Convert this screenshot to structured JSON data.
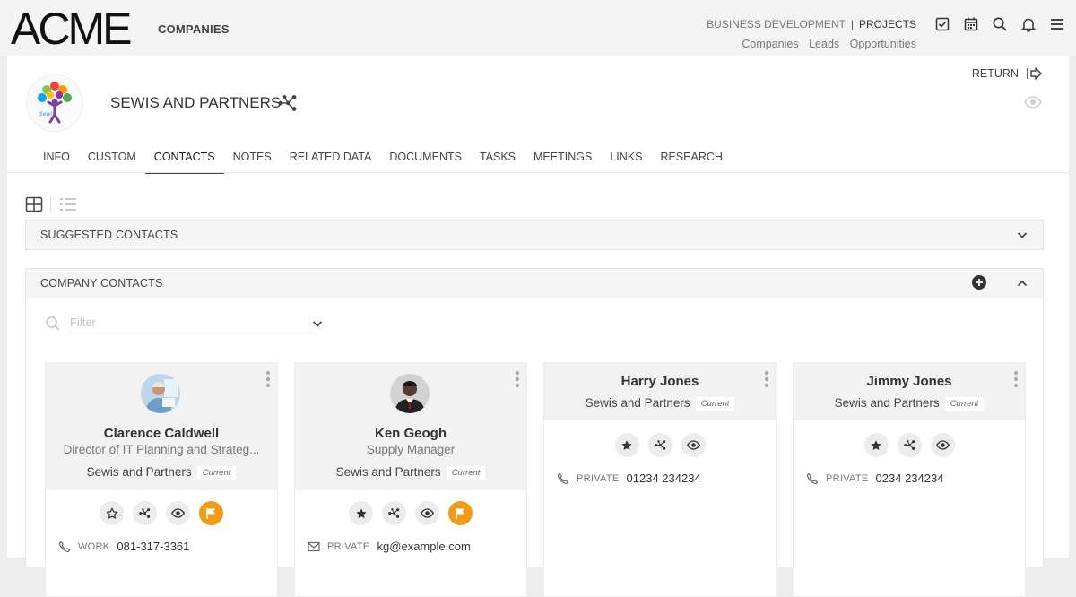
{
  "header": {
    "logo": "ACME",
    "section": "COMPANIES",
    "top_links": [
      "BUSINESS DEVELOPMENT",
      "PROJECTS"
    ],
    "sub_links": [
      "Companies",
      "Leads",
      "Opportunities"
    ]
  },
  "company": {
    "name": "SEWIS AND PARTNERS",
    "return_label": "RETURN",
    "logo_text": "Sewis"
  },
  "tabs": [
    "INFO",
    "CUSTOM",
    "CONTACTS",
    "NOTES",
    "RELATED DATA",
    "DOCUMENTS",
    "TASKS",
    "MEETINGS",
    "LINKS",
    "RESEARCH"
  ],
  "active_tab": "CONTACTS",
  "suggested": {
    "title": "SUGGESTED CONTACTS"
  },
  "company_contacts": {
    "title": "COMPANY CONTACTS",
    "filter_placeholder": "Filter"
  },
  "contacts": [
    {
      "name": "Clarence Caldwell",
      "title": "Director of IT Planning and Strateg...",
      "company": "Sewis and Partners",
      "status": "Current",
      "contact_label": "WORK",
      "contact_value": "081-317-3361"
    },
    {
      "name": "Ken Geogh",
      "title": "Supply Manager",
      "company": "Sewis and Partners",
      "status": "Current",
      "contact_label": "PRIVATE",
      "contact_value": "kg@example.com"
    },
    {
      "name": "Harry Jones",
      "company": "Sewis and Partners",
      "status": "Current",
      "contact_label": "PRIVATE",
      "contact_value": "01234 234234"
    },
    {
      "name": "Jimmy Jones",
      "company": "Sewis and Partners",
      "status": "Current",
      "contact_label": "PRIVATE",
      "contact_value": "0234 234234"
    }
  ],
  "colors": {
    "accent_orange": "#f29b16",
    "header_bg": "#f4f4f4",
    "panel_bg": "#ffffff"
  }
}
